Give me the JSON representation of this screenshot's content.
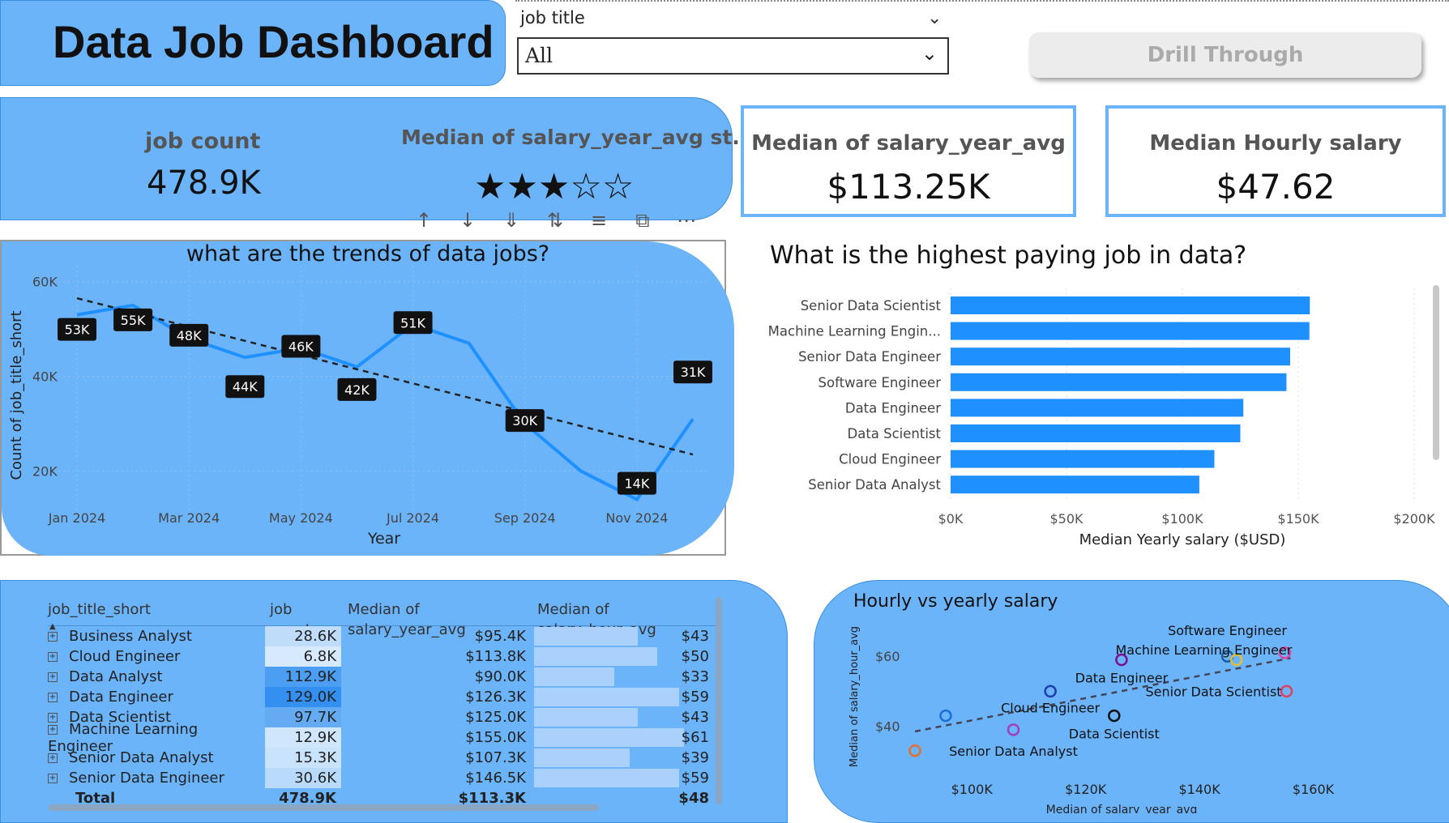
{
  "header": {
    "title": "Data Job Dashboard"
  },
  "slicer": {
    "label": "job title",
    "value": "All"
  },
  "drill_button": {
    "label": "Drill Through"
  },
  "kpis": {
    "job_count_label": "job count",
    "job_count_value": "478.9K",
    "rating_label": "Median of salary_year_avg st...",
    "rating_value": 3,
    "rating_max": 5,
    "median_year_label": "Median of salary_year_avg",
    "median_year_value": "$113.25K",
    "median_hour_label": "Median Hourly salary",
    "median_hour_value": "$47.62"
  },
  "toolbar": {
    "icons": [
      "sort-up-icon",
      "sort-down-icon",
      "expand-all-icon",
      "drill-icon",
      "filter-icon",
      "focus-icon",
      "more-icon"
    ]
  },
  "chart_data": [
    {
      "type": "line",
      "title": "what are the trends of data jobs?",
      "xlabel": "Year",
      "ylabel": "Count of job_title_short",
      "x": [
        "Jan 2024",
        "Feb 2024",
        "Mar 2024",
        "Apr 2024",
        "May 2024",
        "Jun 2024",
        "Jul 2024",
        "Aug 2024",
        "Sep 2024",
        "Oct 2024",
        "Nov 2024",
        "Dec 2024"
      ],
      "x_ticks": [
        "Jan 2024",
        "Mar 2024",
        "May 2024",
        "Jul 2024",
        "Sep 2024",
        "Nov 2024"
      ],
      "values": [
        53,
        55,
        48,
        44,
        46,
        42,
        51,
        47,
        30,
        20,
        14,
        31
      ],
      "data_labels": [
        {
          "i": 0,
          "text": "53K"
        },
        {
          "i": 1,
          "text": "55K"
        },
        {
          "i": 2,
          "text": "48K"
        },
        {
          "i": 3,
          "text": "44K"
        },
        {
          "i": 4,
          "text": "46K"
        },
        {
          "i": 5,
          "text": "42K"
        },
        {
          "i": 6,
          "text": "51K"
        },
        {
          "i": 8,
          "text": "30K"
        },
        {
          "i": 10,
          "text": "14K"
        },
        {
          "i": 11,
          "text": "31K"
        }
      ],
      "trend": [
        56.5,
        23.5
      ],
      "y_ticks": [
        "20K",
        "40K",
        "60K"
      ],
      "y_tick_values": [
        20,
        40,
        60
      ],
      "ylim": [
        10,
        62
      ],
      "line_color": "#1e90ff"
    },
    {
      "type": "bar",
      "orientation": "horizontal",
      "title": "What is the highest paying job in data?",
      "xlabel": "Median Yearly salary ($USD)",
      "categories": [
        "Senior Data Scientist",
        "Machine Learning Engin...",
        "Senior Data Engineer",
        "Software Engineer",
        "Data Engineer",
        "Data Scientist",
        "Cloud Engineer",
        "Senior Data Analyst"
      ],
      "values": [
        155000,
        154800,
        146500,
        144900,
        126300,
        125000,
        113800,
        107300
      ],
      "x_ticks": [
        "$0K",
        "$50K",
        "$100K",
        "$150K",
        "$200K"
      ],
      "xlim": [
        0,
        200000
      ],
      "bar_color": "#1e90ff"
    },
    {
      "type": "scatter",
      "title": "Hourly vs yearly salary",
      "xlabel": "Median of salary_year_avg",
      "ylabel": "Median of salary_hour_avg",
      "x_ticks": [
        "$100K",
        "$120K",
        "$140K",
        "$160K"
      ],
      "x_tick_values": [
        100,
        120,
        140,
        160
      ],
      "y_ticks": [
        "$40",
        "$60"
      ],
      "y_tick_values": [
        40,
        60
      ],
      "xlim": [
        89,
        170
      ],
      "ylim": [
        29,
        67
      ],
      "points": [
        {
          "x": 90.0,
          "y": 33,
          "color": "#e07030",
          "label": ""
        },
        {
          "x": 95.4,
          "y": 43,
          "color": "#1a6fd8",
          "label": ""
        },
        {
          "x": 107.3,
          "y": 39,
          "color": "#a040c0",
          "label": "Senior Data Analyst"
        },
        {
          "x": 113.8,
          "y": 50,
          "color": "#1f3fb0",
          "label": "Cloud Engineer"
        },
        {
          "x": 125.0,
          "y": 43,
          "color": "#111111",
          "label": "Data Scientist"
        },
        {
          "x": 126.3,
          "y": 59,
          "color": "#7a1090",
          "label": "Data Engineer"
        },
        {
          "x": 144.9,
          "y": 60,
          "color": "#1a5fa0",
          "label": "Software Engineer"
        },
        {
          "x": 146.5,
          "y": 59,
          "color": "#e0c030",
          "label": ""
        },
        {
          "x": 155.0,
          "y": 61,
          "color": "#e040a0",
          "label": "Machine Learning Engineer"
        },
        {
          "x": 155.3,
          "y": 50,
          "color": "#e04060",
          "label": "Senior Data Scientist"
        }
      ],
      "trend": [
        [
          90,
          38.5
        ],
        [
          156,
          59.5
        ]
      ]
    }
  ],
  "table": {
    "headers": [
      "job_title_short",
      "job count",
      "Median of salary_year_avg",
      "Median of salary_hour_avg"
    ],
    "rows": [
      {
        "title": "Business Analyst",
        "count": "28.6K",
        "count_shade": 0.15,
        "year": "$95.4K",
        "hour": "$43",
        "hour_frac": 0.61
      },
      {
        "title": "Cloud Engineer",
        "count": "6.8K",
        "count_shade": 0.0,
        "year": "$113.8K",
        "hour": "$50",
        "hour_frac": 0.72
      },
      {
        "title": "Data Analyst",
        "count": "112.9K",
        "count_shade": 0.85,
        "year": "$90.0K",
        "hour": "$33",
        "hour_frac": 0.47
      },
      {
        "title": "Data Engineer",
        "count": "129.0K",
        "count_shade": 1.0,
        "year": "$126.3K",
        "hour": "$59",
        "hour_frac": 0.85
      },
      {
        "title": "Data Scientist",
        "count": "97.7K",
        "count_shade": 0.7,
        "year": "$125.0K",
        "hour": "$43",
        "hour_frac": 0.61
      },
      {
        "title": "Machine Learning Engineer",
        "count": "12.9K",
        "count_shade": 0.05,
        "year": "$155.0K",
        "hour": "$61",
        "hour_frac": 0.88
      },
      {
        "title": "Senior Data Analyst",
        "count": "15.3K",
        "count_shade": 0.08,
        "year": "$107.3K",
        "hour": "$39",
        "hour_frac": 0.56
      },
      {
        "title": "Senior Data Engineer",
        "count": "30.6K",
        "count_shade": 0.18,
        "year": "$146.5K",
        "hour": "$59",
        "hour_frac": 0.85
      }
    ],
    "total": {
      "label": "Total",
      "count": "478.9K",
      "year": "$113.3K",
      "hour": "$48"
    }
  }
}
